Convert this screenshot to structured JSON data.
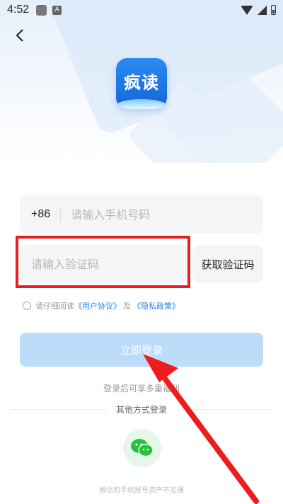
{
  "status_bar": {
    "time": "4:52",
    "a_label": "A"
  },
  "logo": {
    "text": "疯读"
  },
  "phone": {
    "country_code": "+86",
    "placeholder": "请输入手机号码",
    "value": ""
  },
  "code": {
    "placeholder": "请输入验证码",
    "value": "",
    "get_code_label": "获取验证码"
  },
  "agreement": {
    "prefix": "请仔细阅读",
    "user_agreement": "《用户协议》",
    "and": "及",
    "privacy_policy": "《隐私政策》",
    "checked": false
  },
  "login_button": "立即登录",
  "benefit_text": "登录后可享多重福利",
  "other_methods": "其他方式登录",
  "footnote": "微信和手机账号资产不互通",
  "colors": {
    "primary": "#2a7ee6",
    "login_disabled": "#bcdcfa",
    "annotation_red": "#ee1c1c",
    "wechat_green": "#29c13c"
  }
}
